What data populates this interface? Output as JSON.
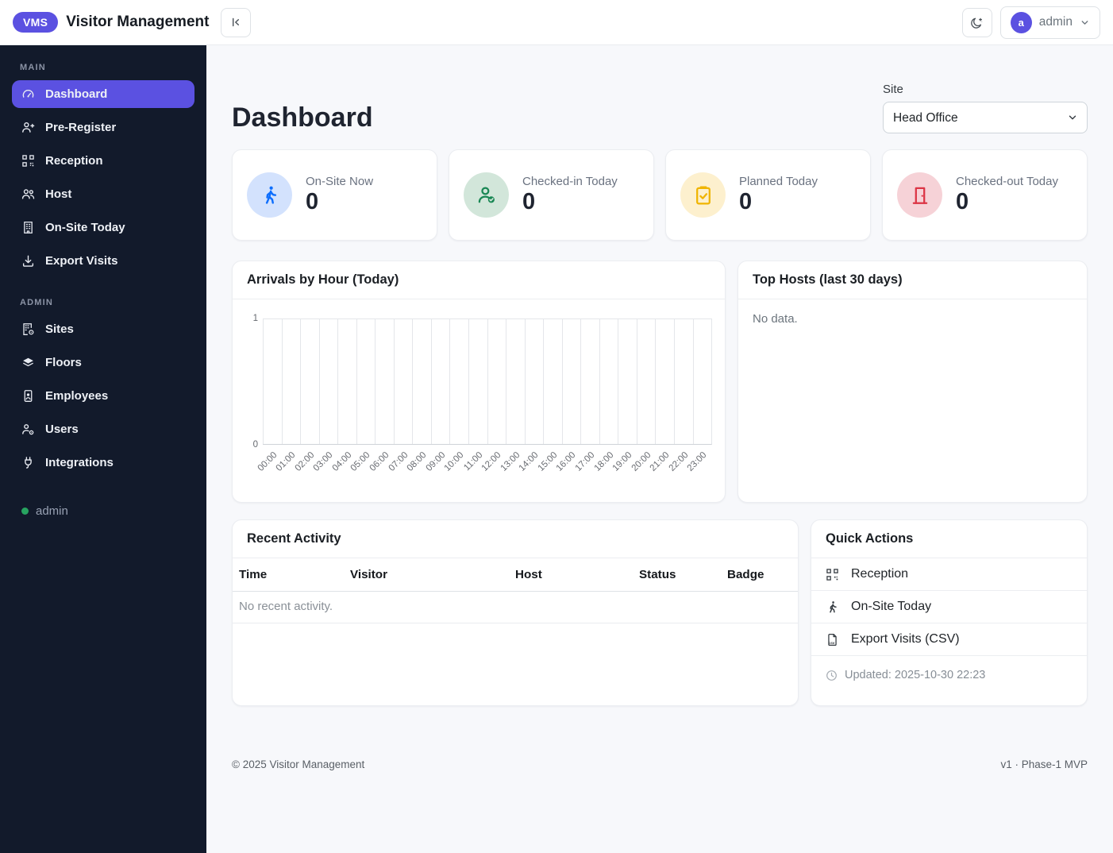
{
  "header": {
    "brand_badge": "VMS",
    "brand_name": "Visitor Management",
    "collapse_button_icon": "chevron-bar-left-icon",
    "theme_button_icon": "moon-stars-icon",
    "user_menu": {
      "avatar_initial": "a",
      "username": "admin",
      "caret_icon": "chevron-down-icon"
    }
  },
  "sidebar": {
    "sections": [
      {
        "label": "MAIN",
        "items": [
          {
            "label": "Dashboard",
            "icon": "speedometer-icon",
            "active": true
          },
          {
            "label": "Pre-Register",
            "icon": "person-plus-icon",
            "active": false
          },
          {
            "label": "Reception",
            "icon": "qr-code-scan-icon",
            "active": false
          },
          {
            "label": "Host",
            "icon": "people-icon",
            "active": false
          },
          {
            "label": "On-Site Today",
            "icon": "building-icon",
            "active": false
          },
          {
            "label": "Export Visits",
            "icon": "download-icon",
            "active": false
          }
        ]
      },
      {
        "label": "ADMIN",
        "items": [
          {
            "label": "Sites",
            "icon": "building-gear-icon",
            "active": false
          },
          {
            "label": "Floors",
            "icon": "layers-icon",
            "active": false
          },
          {
            "label": "Employees",
            "icon": "person-badge-icon",
            "active": false
          },
          {
            "label": "Users",
            "icon": "person-gear-icon",
            "active": false
          },
          {
            "label": "Integrations",
            "icon": "plug-icon",
            "active": false
          }
        ]
      }
    ],
    "user_status": {
      "label": "admin",
      "dot_color": "#27a360"
    }
  },
  "page": {
    "title": "Dashboard"
  },
  "site_selector": {
    "label": "Site",
    "selected_option": "Head Office"
  },
  "stat_cards": [
    {
      "label": "On-Site Now",
      "value": "0",
      "icon": "person-walking-icon",
      "icon_color": "#0d6efd",
      "icon_bg": "#d3e2fd"
    },
    {
      "label": "Checked-in Today",
      "value": "0",
      "icon": "person-check-icon",
      "icon_color": "#198754",
      "icon_bg": "#d2e6da"
    },
    {
      "label": "Planned Today",
      "value": "0",
      "icon": "clipboard-check-icon",
      "icon_color": "#f0b400",
      "icon_bg": "#fdf0ce"
    },
    {
      "label": "Checked-out Today",
      "value": "0",
      "icon": "door-closed-icon",
      "icon_color": "#dc3545",
      "icon_bg": "#f6d2d7"
    }
  ],
  "chart_card": {
    "title": "Arrivals by Hour (Today)"
  },
  "chart_data": {
    "type": "bar",
    "title": "Arrivals by Hour (Today)",
    "categories": [
      "00:00",
      "01:00",
      "02:00",
      "03:00",
      "04:00",
      "05:00",
      "06:00",
      "07:00",
      "08:00",
      "09:00",
      "10:00",
      "11:00",
      "12:00",
      "13:00",
      "14:00",
      "15:00",
      "16:00",
      "17:00",
      "18:00",
      "19:00",
      "20:00",
      "21:00",
      "22:00",
      "23:00"
    ],
    "values": [
      0,
      0,
      0,
      0,
      0,
      0,
      0,
      0,
      0,
      0,
      0,
      0,
      0,
      0,
      0,
      0,
      0,
      0,
      0,
      0,
      0,
      0,
      0,
      0
    ],
    "xlabel": "",
    "ylabel": "",
    "ylim": [
      0,
      1
    ],
    "yticks": [
      "0",
      "1"
    ],
    "grid": true,
    "legend": false,
    "bar_color": "#5b51e1"
  },
  "top_hosts_card": {
    "title": "Top Hosts (last 30 days)",
    "empty_text": "No data."
  },
  "recent_activity_card": {
    "title": "Recent Activity",
    "columns": [
      "Time",
      "Visitor",
      "Host",
      "Status",
      "Badge"
    ],
    "empty_text": "No recent activity."
  },
  "quick_actions_card": {
    "title": "Quick Actions",
    "items": [
      {
        "label": "Reception",
        "icon": "qr-code-scan-icon"
      },
      {
        "label": "On-Site Today",
        "icon": "person-walking-icon"
      },
      {
        "label": "Export Visits (CSV)",
        "icon": "file-csv-icon"
      }
    ],
    "updated_text": "Updated: 2025-10-30 22:23",
    "updated_icon": "clock-icon"
  },
  "footer": {
    "left": "© 2025 Visitor Management",
    "right": "v1 · Phase-1 MVP"
  },
  "colors": {
    "accent": "#5b51e1",
    "sidebar_bg": "#121a2b",
    "page_bg": "#f7f8fb"
  }
}
